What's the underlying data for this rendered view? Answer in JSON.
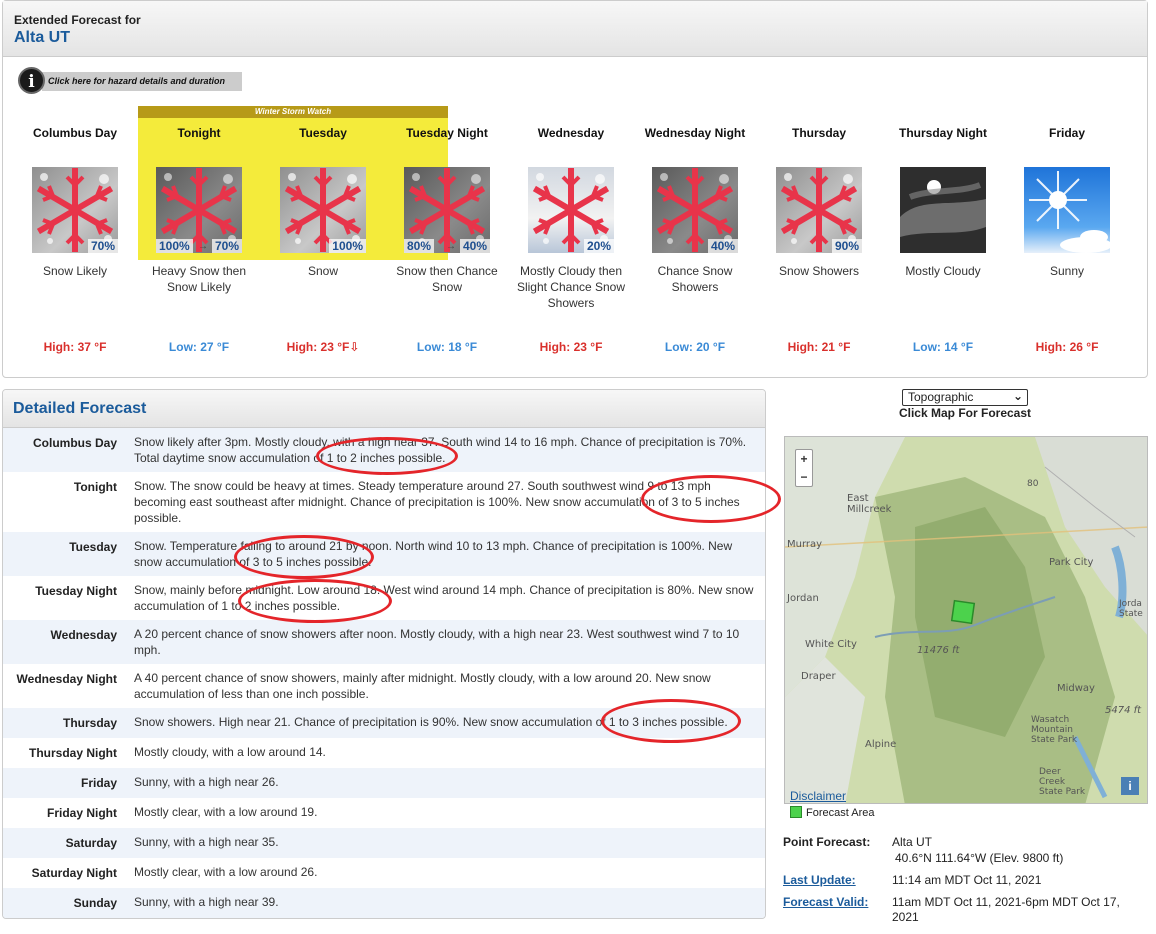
{
  "header": {
    "subtitle": "Extended Forecast for",
    "location": "Alta UT"
  },
  "hazard": {
    "icon": "info-icon",
    "label": "Click here for hazard details and duration"
  },
  "watch": {
    "label": "Winter Storm Watch"
  },
  "periods": [
    {
      "name": "Columbus Day",
      "pop": "70%",
      "pop_start": "",
      "short": "Snow Likely",
      "temp": "High: 37 °F",
      "kind": "hi",
      "icon": "snow-icon"
    },
    {
      "name": "Tonight",
      "pop": "70%",
      "pop_start": "100%",
      "short": "Heavy Snow then Snow Likely",
      "temp": "Low: 27 °F",
      "kind": "lo",
      "icon": "snow-icon"
    },
    {
      "name": "Tuesday",
      "pop": "100%",
      "pop_start": "",
      "short": "Snow",
      "temp": "High: 23 °F⇩",
      "kind": "hi",
      "icon": "snow-icon"
    },
    {
      "name": "Tuesday Night",
      "pop": "40%",
      "pop_start": "80%",
      "short": "Snow then Chance Snow",
      "temp": "Low: 18 °F",
      "kind": "lo",
      "icon": "snow-icon"
    },
    {
      "name": "Wednesday",
      "pop": "20%",
      "pop_start": "",
      "short": "Mostly Cloudy then Slight Chance Snow Showers",
      "temp": "High: 23 °F",
      "kind": "hi",
      "icon": "snow-cloud-icon"
    },
    {
      "name": "Wednesday Night",
      "pop": "40%",
      "pop_start": "",
      "short": "Chance Snow Showers",
      "temp": "Low: 20 °F",
      "kind": "lo",
      "icon": "snow-icon"
    },
    {
      "name": "Thursday",
      "pop": "90%",
      "pop_start": "",
      "short": "Snow Showers",
      "temp": "High: 21 °F",
      "kind": "hi",
      "icon": "snow-icon"
    },
    {
      "name": "Thursday Night",
      "pop": "",
      "pop_start": "",
      "short": "Mostly Cloudy",
      "temp": "Low: 14 °F",
      "kind": "lo",
      "icon": "night-cloud-icon"
    },
    {
      "name": "Friday",
      "pop": "",
      "pop_start": "",
      "short": "Sunny",
      "temp": "High: 26 °F",
      "kind": "hi",
      "icon": "sun-icon"
    }
  ],
  "detailed": {
    "title": "Detailed Forecast",
    "rows": [
      {
        "label": "Columbus Day",
        "text": "Snow likely after 3pm. Mostly cloudy, with a high near 37. South wind 14 to 16 mph. Chance of precipitation is 70%. Total daytime snow accumulation of 1 to 2 inches possible."
      },
      {
        "label": "Tonight",
        "text": "Snow. The snow could be heavy at times. Steady temperature around 27. South southwest wind 9 to 13 mph becoming east southeast after midnight. Chance of precipitation is 100%. New snow accumulation of 3 to 5 inches possible."
      },
      {
        "label": "Tuesday",
        "text": "Snow. Temperature falling to around 21 by noon. North wind 10 to 13 mph. Chance of precipitation is 100%. New snow accumulation of 3 to 5 inches possible."
      },
      {
        "label": "Tuesday Night",
        "text": "Snow, mainly before midnight. Low around 18. West wind around 14 mph. Chance of precipitation is 80%. New snow accumulation of 1 to 2 inches possible."
      },
      {
        "label": "Wednesday",
        "text": "A 20 percent chance of snow showers after noon. Mostly cloudy, with a high near 23. West southwest wind 7 to 10 mph."
      },
      {
        "label": "Wednesday Night",
        "text": "A 40 percent chance of snow showers, mainly after midnight. Mostly cloudy, with a low around 20. New snow accumulation of less than one inch possible."
      },
      {
        "label": "Thursday",
        "text": "Snow showers. High near 21. Chance of precipitation is 90%. New snow accumulation of 1 to 3 inches possible."
      },
      {
        "label": "Thursday Night",
        "text": "Mostly cloudy, with a low around 14."
      },
      {
        "label": "Friday",
        "text": "Sunny, with a high near 26."
      },
      {
        "label": "Friday Night",
        "text": "Mostly clear, with a low around 19."
      },
      {
        "label": "Saturday",
        "text": "Sunny, with a high near 35."
      },
      {
        "label": "Saturday Night",
        "text": "Mostly clear, with a low around 26."
      },
      {
        "label": "Sunday",
        "text": "Sunny, with a high near 39."
      }
    ]
  },
  "map": {
    "select_value": "Topographic",
    "click_label": "Click Map For Forecast",
    "zoom_in": "+",
    "zoom_out": "−",
    "info": "i",
    "disclaimer": "Disclaimer",
    "legend": "Forecast Area",
    "places": [
      "East Millcreek",
      "Murray",
      "Park City",
      "Jordan",
      "Jorda State",
      "White City",
      "11476 ft",
      "Draper",
      "Midway",
      "Wasatch Mountain State Park",
      "5474 ft",
      "Alpine",
      "Deer Creek State Park",
      "80"
    ]
  },
  "point": {
    "k1": "Point Forecast:",
    "v1": "Alta UT",
    "v1b": "40.6°N 111.64°W (Elev. 9800 ft)",
    "k2": "Last Update:",
    "v2": "11:14 am MDT Oct 11, 2021",
    "k3": "Forecast Valid:",
    "v3": "11am MDT Oct 11, 2021-6pm MDT Oct 17, 2021"
  },
  "colors": {
    "high": "#d9302c",
    "low": "#3a8ad6",
    "link": "#1b5b9b",
    "watch": "#f4eb3b",
    "highlight": "#e4252a"
  }
}
